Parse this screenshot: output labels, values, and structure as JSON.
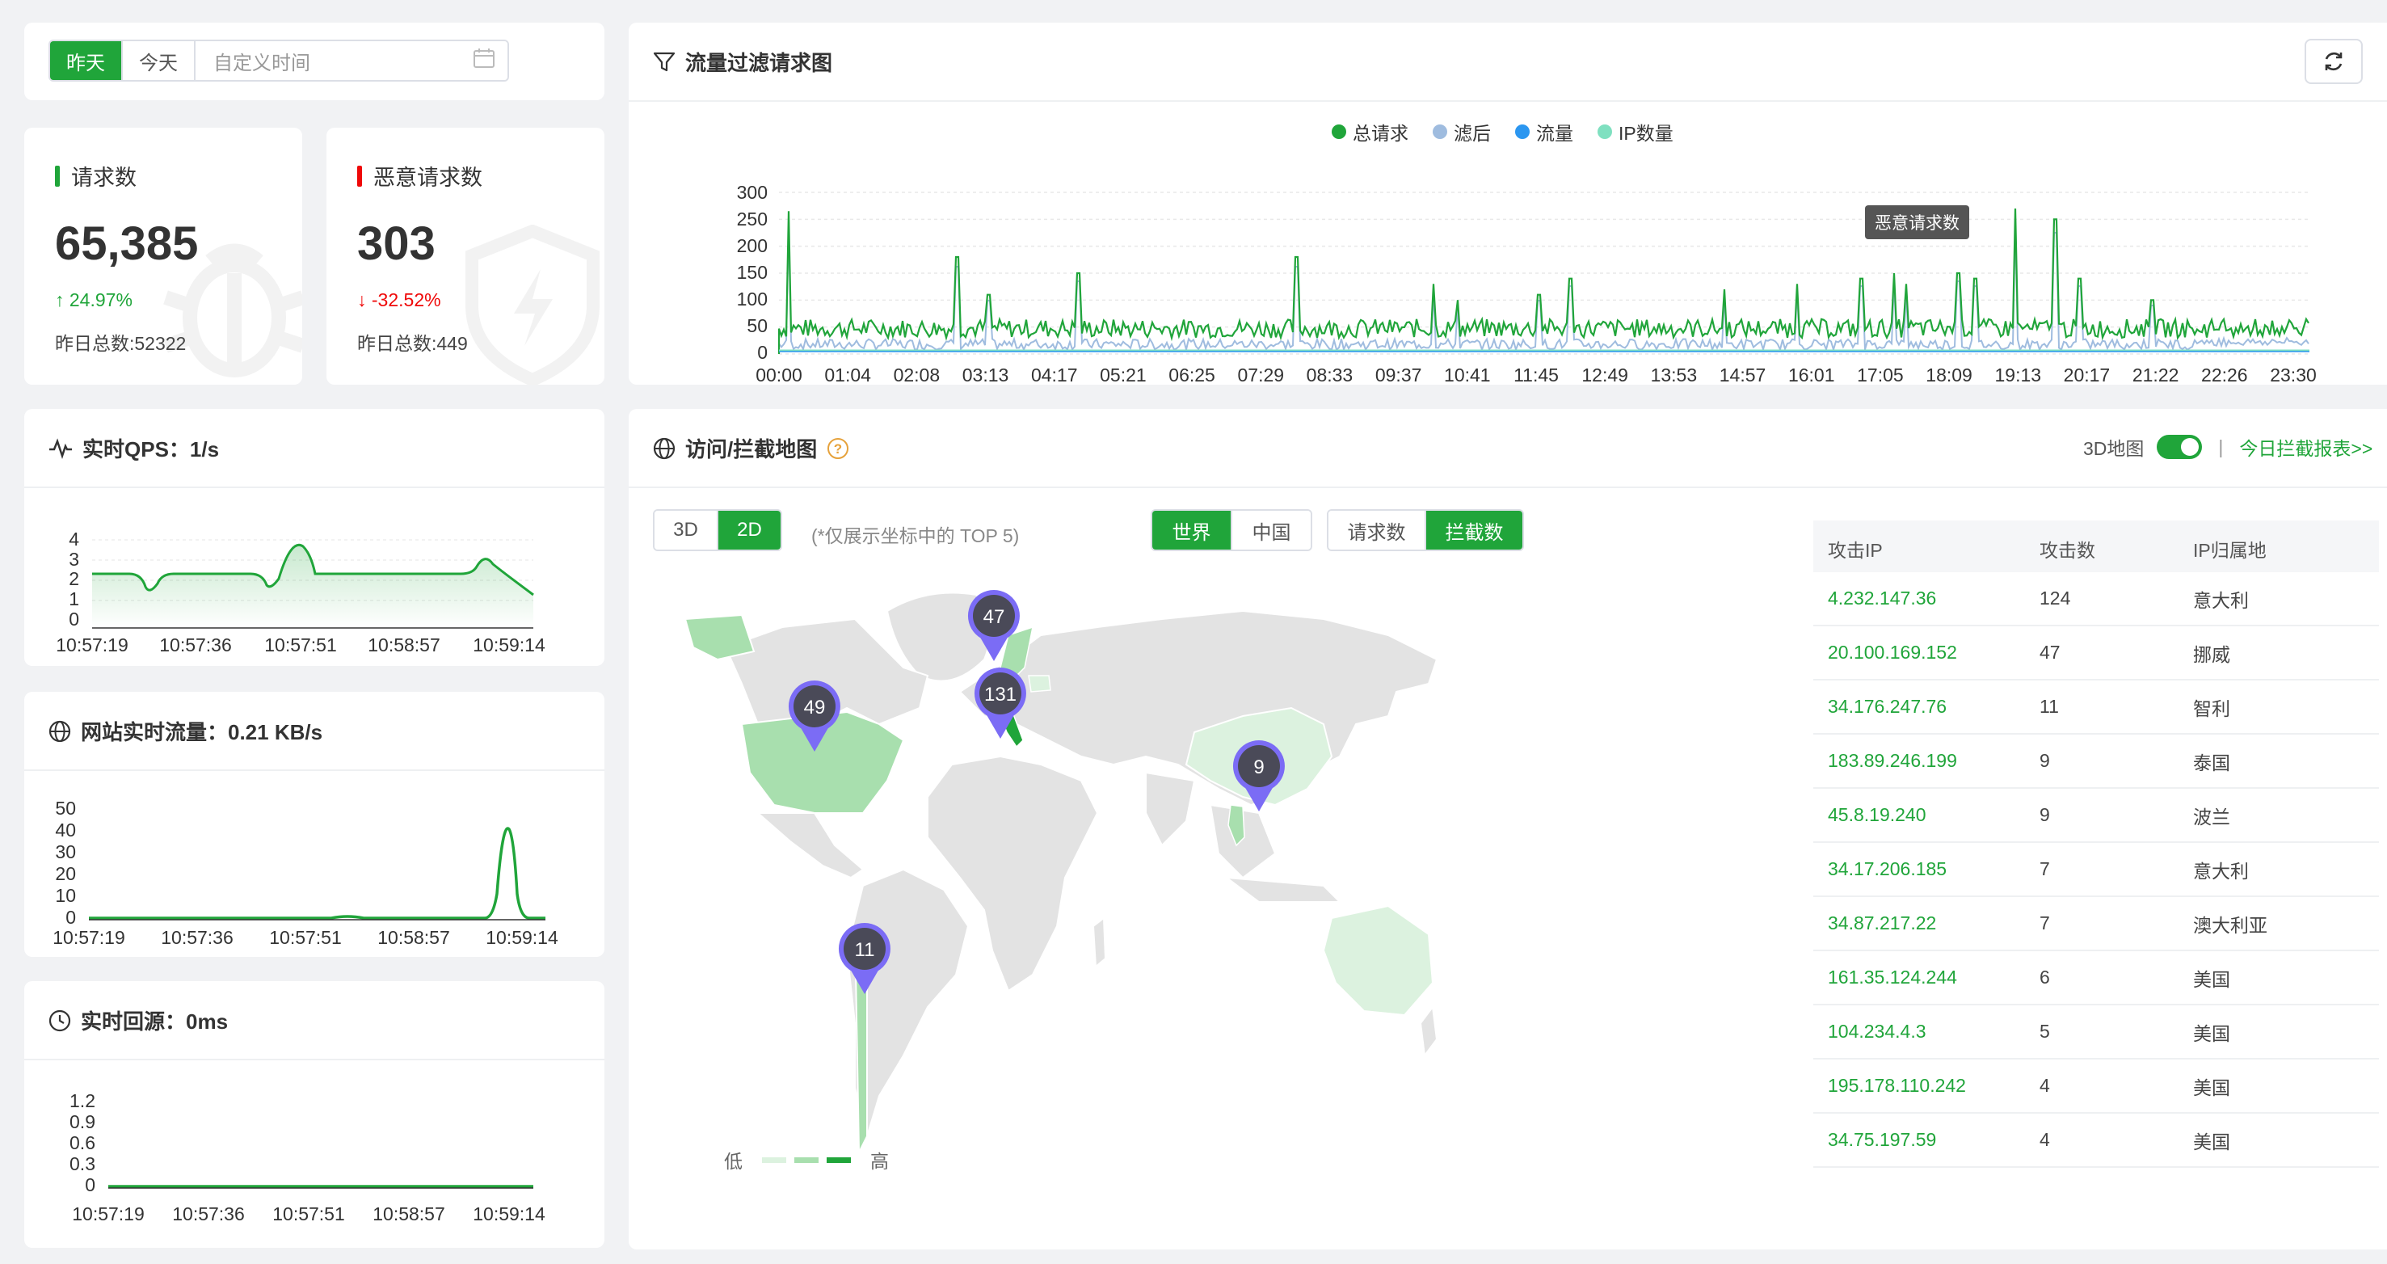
{
  "date_filter": {
    "yesterday": "昨天",
    "today": "今天",
    "custom_placeholder": "自定义时间"
  },
  "stats": {
    "requests": {
      "label": "请求数",
      "value": "65,385",
      "change": "↑ 24.97%",
      "yesterday": "昨日总数:52322",
      "bar_color": "#20a53a",
      "change_color": "#20a53a"
    },
    "malicious": {
      "label": "恶意请求数",
      "value": "303",
      "change": "↓ -32.52%",
      "yesterday": "昨日总数:449",
      "bar_color": "#ef0808",
      "change_color": "#ef0808"
    }
  },
  "qps": {
    "title": "实时QPS：1/s",
    "y_ticks": [
      "4",
      "3",
      "2",
      "1",
      "0"
    ],
    "x_ticks": [
      "10:57:19",
      "10:57:36",
      "10:57:51",
      "10:58:57",
      "10:59:14"
    ]
  },
  "traffic": {
    "title": "网站实时流量：0.21 KB/s",
    "y_ticks": [
      "50",
      "40",
      "30",
      "20",
      "10",
      "0"
    ],
    "x_ticks": [
      "10:57:19",
      "10:57:36",
      "10:57:51",
      "10:58:57",
      "10:59:14"
    ]
  },
  "origin": {
    "title": "实时回源：0ms",
    "y_ticks": [
      "1.2",
      "0.9",
      "0.6",
      "0.3",
      "0"
    ],
    "x_ticks": [
      "10:57:19",
      "10:57:36",
      "10:57:51",
      "10:58:57",
      "10:59:14"
    ]
  },
  "flow_chart": {
    "title": "流量过滤请求图",
    "legend": [
      {
        "name": "总请求",
        "color": "#20a53a"
      },
      {
        "name": "滤后",
        "color": "#9fbcdf"
      },
      {
        "name": "流量",
        "color": "#2b96f0"
      },
      {
        "name": "IP数量",
        "color": "#7fe0c0"
      }
    ],
    "tooltip": "恶意请求数",
    "y_ticks": [
      "300",
      "250",
      "200",
      "150",
      "100",
      "50",
      "0"
    ],
    "x_ticks": [
      "00:00",
      "01:04",
      "02:08",
      "03:13",
      "04:17",
      "05:21",
      "06:25",
      "07:29",
      "08:33",
      "09:37",
      "10:41",
      "11:45",
      "12:49",
      "13:53",
      "14:57",
      "16:01",
      "17:05",
      "18:09",
      "19:13",
      "20:17",
      "21:22",
      "22:26",
      "23:30"
    ]
  },
  "map_panel": {
    "title": "访问/拦截地图",
    "toggle_label": "3D地图",
    "report_link": "今日拦截报表>>",
    "view_3d": "3D",
    "view_2d": "2D",
    "hint": "(*仅展示坐标中的 TOP 5)",
    "scope_world": "世界",
    "scope_china": "中国",
    "metric_requests": "请求数",
    "metric_blocks": "拦截数",
    "legend_low": "低",
    "legend_high": "高",
    "pins": [
      "47",
      "131",
      "49",
      "9",
      "11"
    ]
  },
  "attack_table": {
    "headers": [
      "攻击IP",
      "攻击数",
      "IP归属地"
    ],
    "rows": [
      {
        "ip": "4.232.147.36",
        "count": "124",
        "loc": "意大利"
      },
      {
        "ip": "20.100.169.152",
        "count": "47",
        "loc": "挪威"
      },
      {
        "ip": "34.176.247.76",
        "count": "11",
        "loc": "智利"
      },
      {
        "ip": "183.89.246.199",
        "count": "9",
        "loc": "泰国"
      },
      {
        "ip": "45.8.19.240",
        "count": "9",
        "loc": "波兰"
      },
      {
        "ip": "34.17.206.185",
        "count": "7",
        "loc": "意大利"
      },
      {
        "ip": "34.87.217.22",
        "count": "7",
        "loc": "澳大利亚"
      },
      {
        "ip": "161.35.124.244",
        "count": "6",
        "loc": "美国"
      },
      {
        "ip": "104.234.4.3",
        "count": "5",
        "loc": "美国"
      },
      {
        "ip": "195.178.110.242",
        "count": "4",
        "loc": "美国"
      },
      {
        "ip": "34.75.197.59",
        "count": "4",
        "loc": "美国"
      }
    ]
  }
}
